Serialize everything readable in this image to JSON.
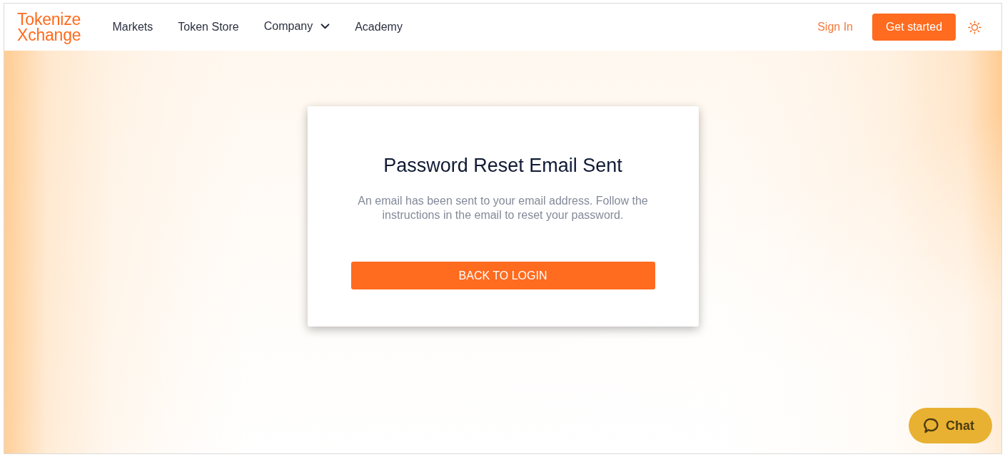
{
  "header": {
    "logo": {
      "line_1": "Tokenize",
      "line_2": "Xchange"
    },
    "nav": [
      {
        "label": "Markets",
        "kind": "link"
      },
      {
        "label": "Token Store",
        "kind": "link"
      },
      {
        "label": "Company",
        "kind": "dropdown"
      },
      {
        "label": "Academy",
        "kind": "link"
      }
    ],
    "sign_in": "Sign In",
    "get_started": "Get started"
  },
  "card": {
    "title": "Password Reset Email Sent",
    "message": "An email has been sent to your email address. Follow the instructions in the email to reset your password.",
    "button": "BACK TO LOGIN"
  },
  "chat": {
    "label": "Chat"
  }
}
